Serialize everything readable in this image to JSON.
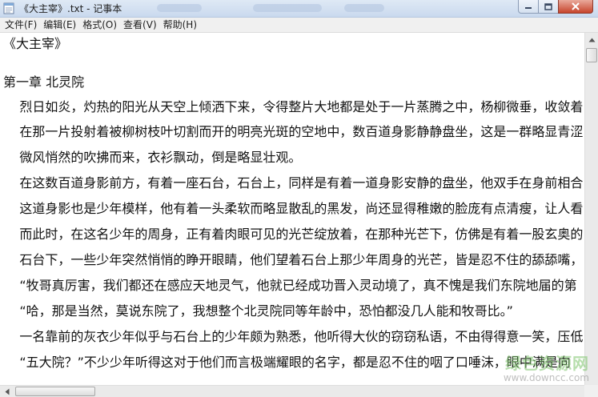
{
  "window": {
    "title": "《大主宰》.txt - 记事本",
    "buttons": {
      "minimize": "minimize-icon",
      "maximize": "maximize-icon",
      "close": "close-icon"
    }
  },
  "menubar": {
    "items": [
      {
        "label": "文件(F)"
      },
      {
        "label": "编辑(E)"
      },
      {
        "label": "格式(O)"
      },
      {
        "label": "查看(V)"
      },
      {
        "label": "帮助(H)"
      }
    ]
  },
  "document": {
    "lines": [
      "《大主宰》",
      "",
      "第一章 北灵院",
      "    烈日如炎，灼热的阳光从天空上倾洒下来，令得整片大地都是处于一片蒸腾之中，杨柳微垂，收敛着",
      "    在那一片投射着被柳树枝叶切割而开的明亮光斑的空地中，数百道身影静静盘坐，这是一群略显青涩",
      "    微风悄然的吹拂而来，衣衫飘动，倒是略显壮观。",
      "    在这数百道身影前方，有着一座石台，石台上，同样是有着一道身影安静的盘坐，他双手在身前相合",
      "    这道身影也是少年模样，他有着一头柔软而略显散乱的黑发，尚还显得稚嫩的脸庞有点清瘦，让人看",
      "    而此时，在这名少年的周身，正有着肉眼可见的光芒绽放着，在那种光芒下，仿佛是有着一股玄奥的",
      "    石台下，一些少年突然悄悄的睁开眼睛，他们望着石台上那少年周身的光芒，皆是忍不住的舔舔嘴，",
      "    “牧哥真厉害，我们都还在感应天地灵气，他就已经成功晋入灵动境了，真不愧是我们东院地届的第",
      "    “哈，那是当然，莫说东院了，我想整个北灵院同等年龄中，恐怕都没几人能和牧哥比。”",
      "    一名靠前的灰衣少年似乎与石台上的少年颇为熟悉，他听得大伙的窃窃私语，不由得得意一笑，压低",
      "    “五大院？”不少少年听得这对于他们而言极端耀眼的名字，都是忍不住的咽了口唾沫，眼中满是向"
    ]
  },
  "watermark": {
    "main": "绿色资源网",
    "sub": "www.downcc.com"
  },
  "colors": {
    "titlebar": "#c9d9ee",
    "menubar": "#f0f0f0",
    "close_button": "#c7442b",
    "watermark_green": "#7cc46a"
  }
}
